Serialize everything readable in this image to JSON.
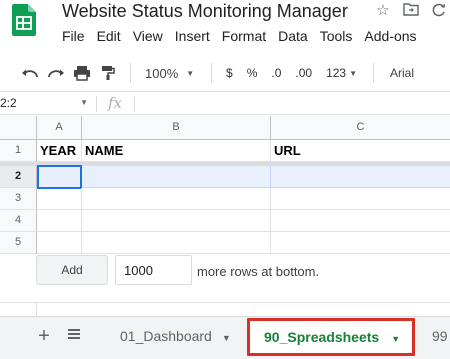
{
  "app": {
    "doc_title": "Website Status Monitoring Manager",
    "menu": [
      "File",
      "Edit",
      "View",
      "Insert",
      "Format",
      "Data",
      "Tools",
      "Add-ons"
    ]
  },
  "toolbar": {
    "zoom": "100%",
    "currency": "$",
    "percent": "%",
    "decrease_decimals": ".0",
    "increase_decimals": ".00",
    "more_formats": "123",
    "font": "Arial"
  },
  "formula_bar": {
    "name_box": "2:2",
    "fx": "fx",
    "formula": ""
  },
  "grid": {
    "columns": [
      "A",
      "B",
      "C"
    ],
    "rows": [
      "1",
      "2",
      "3",
      "4",
      "5"
    ],
    "header_row": [
      "YEAR",
      "NAME",
      "URL"
    ]
  },
  "add_rows": {
    "button_label": "Add",
    "count": "1000",
    "suffix": "more rows at bottom."
  },
  "tabs": {
    "add_symbol": "+",
    "items": [
      "01_Dashboard",
      "90_Spreadsheets",
      "99"
    ],
    "active": "90_Spreadsheets"
  },
  "colors": {
    "sheets_green": "#0f9d58",
    "selection_blue": "#1a73e8",
    "active_tab_text": "#188038",
    "highlight_border": "#d93025"
  }
}
